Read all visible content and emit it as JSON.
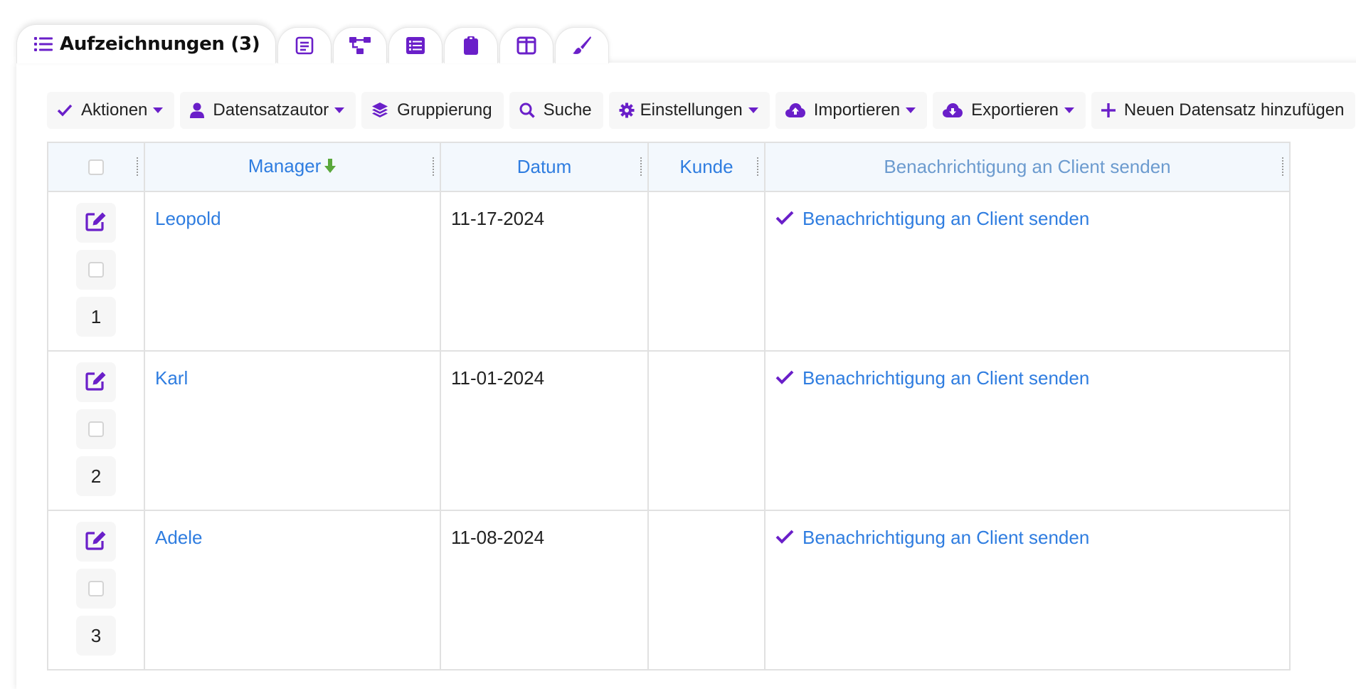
{
  "tabs": {
    "active_label": "Aufzeichnungen (3)",
    "icons": [
      "list-icon",
      "form-icon",
      "sitemap-icon",
      "detail-list-icon",
      "clipboard-icon",
      "columns-icon",
      "brush-icon"
    ]
  },
  "colors": {
    "accent": "#6a1fc9",
    "link": "#2f7de0",
    "header_bg": "#f3f8fd",
    "sort_arrow": "#5aa83c"
  },
  "toolbar": {
    "aktionen": "Aktionen",
    "datensatzautor": "Datensatzautor",
    "gruppierung": "Gruppierung",
    "suche": "Suche",
    "einstellungen": "Einstellungen",
    "importieren": "Importieren",
    "exportieren": "Exportieren",
    "neu": "Neuen Datensatz hinzufügen"
  },
  "table": {
    "headers": {
      "manager": "Manager",
      "datum": "Datum",
      "kunde": "Kunde",
      "notify": "Benachrichtigung an Client senden"
    },
    "rows": [
      {
        "num": "1",
        "manager": "Leopold",
        "datum": "11-17-2024",
        "kunde": "",
        "notify": "Benachrichtigung an Client senden"
      },
      {
        "num": "2",
        "manager": "Karl",
        "datum": "11-01-2024",
        "kunde": "",
        "notify": "Benachrichtigung an Client senden"
      },
      {
        "num": "3",
        "manager": "Adele",
        "datum": "11-08-2024",
        "kunde": "",
        "notify": "Benachrichtigung an Client senden"
      }
    ]
  }
}
